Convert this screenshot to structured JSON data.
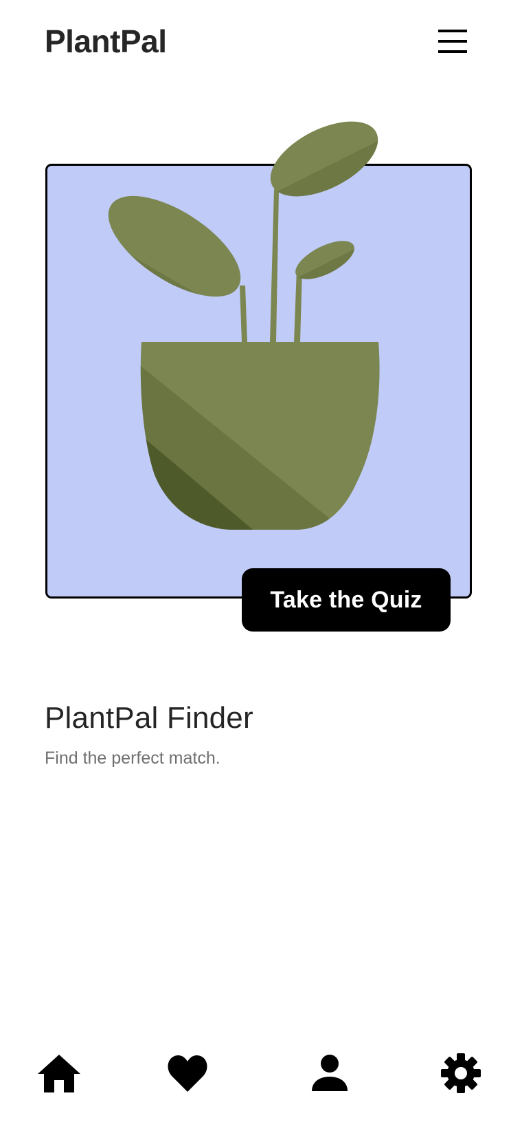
{
  "header": {
    "app_title": "PlantPal",
    "menu_icon": "hamburger-menu-icon"
  },
  "hero": {
    "background_color": "#c0cbf8",
    "illustration": "potted-plant-illustration",
    "quiz_button_label": "Take the Quiz"
  },
  "section": {
    "title": "PlantPal Finder",
    "subtitle": "Find the perfect match."
  },
  "bottom_nav": {
    "items": [
      {
        "icon": "home-icon"
      },
      {
        "icon": "heart-icon"
      },
      {
        "icon": "user-icon"
      },
      {
        "icon": "gear-icon"
      }
    ]
  },
  "colors": {
    "plant_green": "#7b8650",
    "plant_shadow": "#4f5a2b",
    "button_bg": "#000000",
    "subtitle_text": "#707070"
  }
}
